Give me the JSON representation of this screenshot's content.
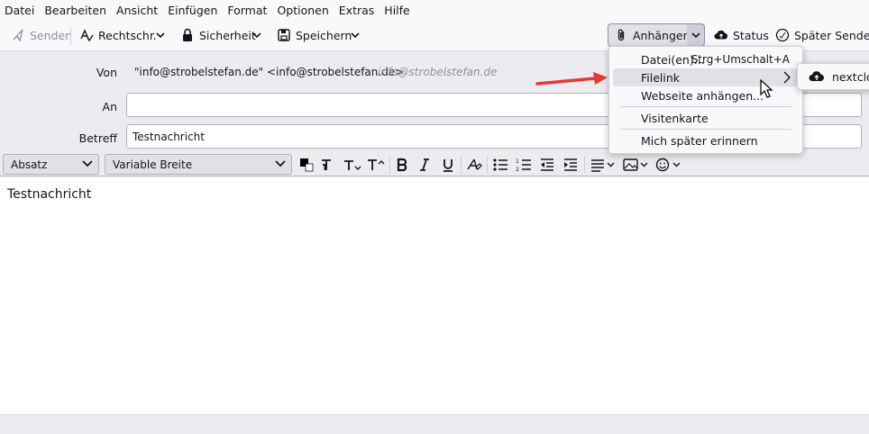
{
  "menubar": {
    "items": [
      {
        "label": "Datei"
      },
      {
        "label": "Bearbeiten"
      },
      {
        "label": "Ansicht"
      },
      {
        "label": "Einfügen"
      },
      {
        "label": "Format"
      },
      {
        "label": "Optionen"
      },
      {
        "label": "Extras"
      },
      {
        "label": "Hilfe"
      }
    ]
  },
  "toolbar": {
    "send_label": "Senden",
    "spelling_label": "Rechtschr.",
    "security_label": "Sicherheit",
    "save_label": "Speichern",
    "attach_label": "Anhängen",
    "status_label": "Status",
    "send_later_label": "Später Senden"
  },
  "headers": {
    "from_label": "Von",
    "from_value": "\"info@strobelstefan.de\" <info@strobelstefan.de>",
    "from_identity": "info@strobelstefan.de",
    "to_label": "An",
    "to_value": "",
    "subject_label": "Betreff",
    "subject_value": "Testnachricht"
  },
  "formatbar": {
    "paragraph_format": "Absatz",
    "font": "Variable Breite"
  },
  "editor": {
    "body_text": "Testnachricht"
  },
  "attach_menu": {
    "items": [
      {
        "label": "Datei(en)...",
        "accel": "Strg+Umschalt+A"
      },
      {
        "label": "Filelink"
      },
      {
        "label": "Webseite anhängen..."
      },
      {
        "label": "Visitenkarte"
      },
      {
        "label": "Mich später erinnern"
      }
    ]
  },
  "filelink_submenu": {
    "items": [
      {
        "label": "nextcloud"
      }
    ]
  },
  "colors": {
    "accent_arrow": "#e53935",
    "menu_highlight": "#e0e0e6",
    "header_bg": "#ececf0"
  }
}
